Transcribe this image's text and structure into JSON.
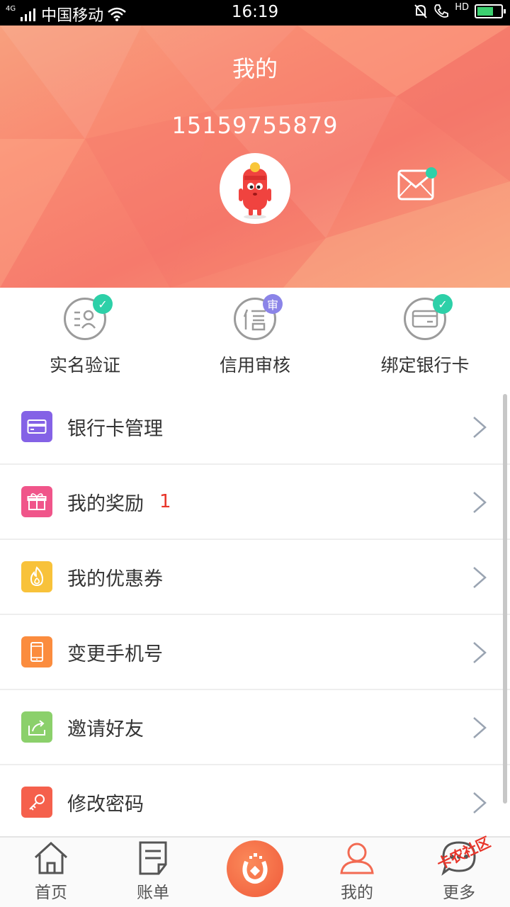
{
  "status_bar": {
    "network": "4G",
    "carrier": "中国移动",
    "time": "16:19",
    "hd": "HD"
  },
  "header": {
    "title": "我的",
    "phone": "15159755879"
  },
  "verification": [
    {
      "label": "实名验证",
      "icon": "id-card-icon",
      "badge": "check",
      "badge_color": "#2dd0a8"
    },
    {
      "label": "信用审核",
      "icon": "credit-icon",
      "badge": "审",
      "badge_color": "#8b84e8"
    },
    {
      "label": "绑定银行卡",
      "icon": "bank-card-icon",
      "badge": "check",
      "badge_color": "#2dd0a8"
    }
  ],
  "menu": [
    {
      "label": "银行卡管理",
      "icon": "card-icon",
      "color": "#8462e6"
    },
    {
      "label": "我的奖励",
      "icon": "gift-icon",
      "color": "#f0558a",
      "badge": "1"
    },
    {
      "label": "我的优惠券",
      "icon": "flame-icon",
      "color": "#f8c23a"
    },
    {
      "label": "变更手机号",
      "icon": "mobile-icon",
      "color": "#fb8c3e"
    },
    {
      "label": "邀请好友",
      "icon": "share-icon",
      "color": "#8bd06b"
    },
    {
      "label": "修改密码",
      "icon": "key-icon",
      "color": "#f5604c"
    }
  ],
  "tabs": [
    {
      "label": "首页",
      "icon": "home-icon"
    },
    {
      "label": "账单",
      "icon": "bill-icon"
    },
    {
      "label": "",
      "icon": "center-logo-icon"
    },
    {
      "label": "我的",
      "icon": "user-icon",
      "active": true
    },
    {
      "label": "更多",
      "icon": "more-icon"
    }
  ],
  "watermark": "卡农社区",
  "colors": {
    "accent": "#f26a52",
    "header_start": "#f8a07e",
    "header_end": "#f67a6c",
    "check": "#2dd0a8"
  }
}
